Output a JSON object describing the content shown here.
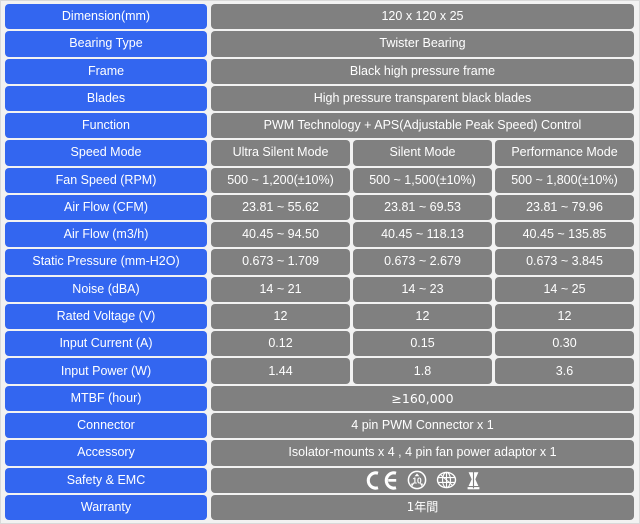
{
  "table": {
    "colors": {
      "label_background": "#3366f0",
      "value_background": "#808080",
      "page_background": "#f2f2f2",
      "text": "#ffffff"
    },
    "simple_rows": [
      {
        "label": "Dimension(mm)",
        "value": "120 x 120 x 25"
      },
      {
        "label": "Bearing Type",
        "value": "Twister Bearing"
      },
      {
        "label": "Frame",
        "value": "Black high pressure frame"
      },
      {
        "label": "Blades",
        "value": "High pressure transparent black blades"
      },
      {
        "label": "Function",
        "value": "PWM Technology + APS(Adjustable Peak Speed) Control"
      }
    ],
    "mode_rows": [
      {
        "label": "Speed Mode",
        "values": [
          "Ultra Silent Mode",
          "Silent Mode",
          "Performance Mode"
        ]
      },
      {
        "label": "Fan Speed (RPM)",
        "values": [
          "500 ~ 1,200(±10%)",
          "500 ~ 1,500(±10%)",
          "500 ~ 1,800(±10%)"
        ]
      },
      {
        "label": "Air Flow (CFM)",
        "values": [
          "23.81 ~ 55.62",
          "23.81 ~ 69.53",
          "23.81 ~ 79.96"
        ]
      },
      {
        "label": "Air Flow (m3/h)",
        "values": [
          "40.45 ~ 94.50",
          "40.45 ~ 118.13",
          "40.45 ~ 135.85"
        ]
      },
      {
        "label": "Static Pressure (mm-H2O)",
        "values": [
          "0.673 ~ 1.709",
          "0.673 ~ 2.679",
          "0.673 ~ 3.845"
        ]
      },
      {
        "label": "Noise (dBA)",
        "values": [
          "14 ~ 21",
          "14 ~ 23",
          "14 ~ 25"
        ]
      },
      {
        "label": "Rated Voltage (V)",
        "values": [
          "12",
          "12",
          "12"
        ]
      },
      {
        "label": "Input Current (A)",
        "values": [
          "0.12",
          "0.15",
          "0.30"
        ]
      },
      {
        "label": "Input Power (W)",
        "values": [
          "1.44",
          "1.8",
          "3.6"
        ]
      }
    ],
    "footer_rows": [
      {
        "label": "MTBF (hour)",
        "value": "≥160,000"
      },
      {
        "label": "Connector",
        "value": "4 pin PWM Connector x 1"
      },
      {
        "label": "Accessory",
        "value": "Isolator-mounts x 4 , 4 pin fan power adaptor x 1"
      }
    ],
    "safety_row": {
      "label": "Safety & EMC",
      "icons": [
        {
          "name": "ce-mark-icon",
          "title": "CE"
        },
        {
          "name": "rohs-10-mark-icon",
          "title": "10"
        },
        {
          "name": "ccc-globe-mark-icon",
          "title": ""
        },
        {
          "name": "weee-crossed-bin-icon",
          "title": ""
        }
      ]
    },
    "warranty_row": {
      "label": "Warranty",
      "value": "1年間"
    }
  }
}
